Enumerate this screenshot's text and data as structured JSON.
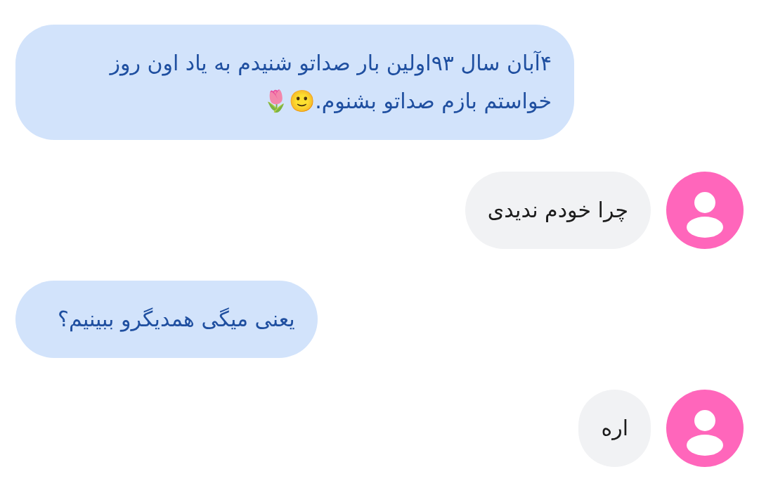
{
  "messages": [
    {
      "kind": "sent",
      "text": "۴آبان سال ۹۳اولین بار صداتو شنیدم به یاد اون روز خواستم بازم صداتو بشنوم.🙂🌷"
    },
    {
      "kind": "received",
      "text": "چرا خودم ندیدی"
    },
    {
      "kind": "sent",
      "text": "یعنی میگی همدیگرو ببینیم؟"
    },
    {
      "kind": "received",
      "text": "اره"
    }
  ]
}
